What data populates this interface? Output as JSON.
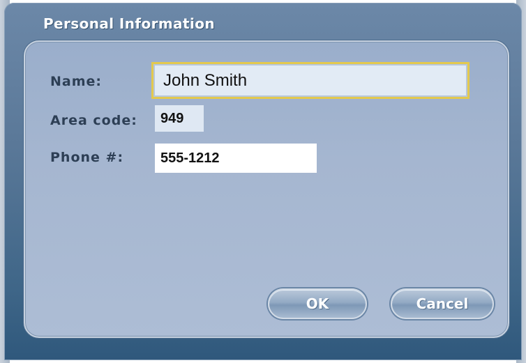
{
  "dialog": {
    "title": "Personal Information"
  },
  "form": {
    "name_label": "Name:",
    "name_value": "John Smith",
    "area_code_label": "Area code:",
    "area_code_value": "949",
    "phone_label": "Phone #:",
    "phone_value": "555-1212"
  },
  "buttons": {
    "ok_label": "OK",
    "cancel_label": "Cancel"
  },
  "colors": {
    "focus_border": "#e3c94e",
    "panel": "#a5b6d0",
    "dialog": "#5a7898"
  }
}
